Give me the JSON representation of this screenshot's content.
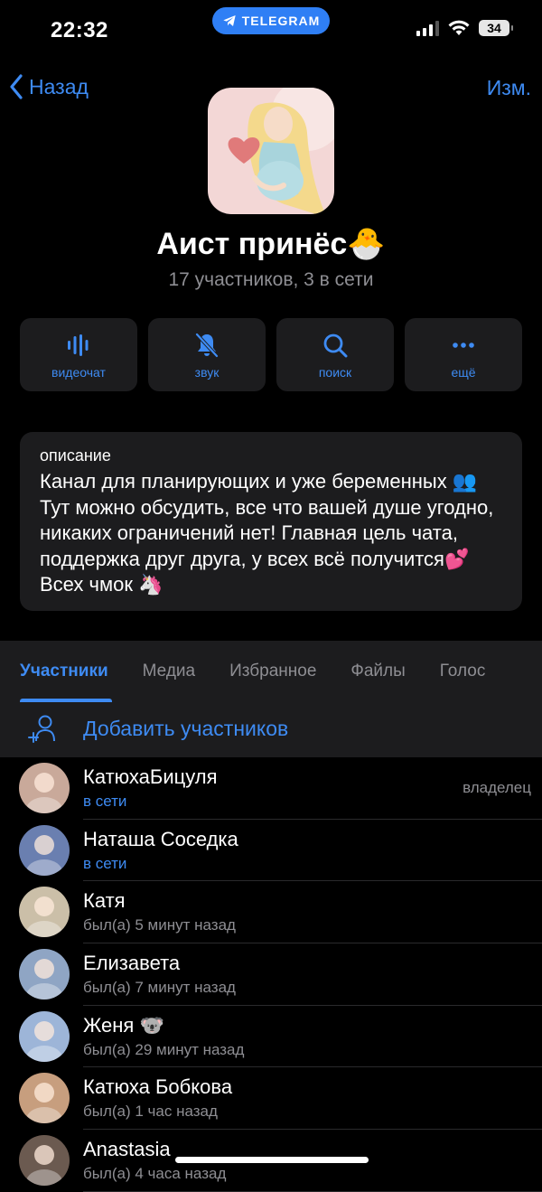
{
  "status": {
    "time": "22:32",
    "pill": "TELEGRAM",
    "battery": "34"
  },
  "nav": {
    "back_label": "Назад",
    "edit_label": "Изм."
  },
  "group": {
    "title": "Аист принёс🐣",
    "subtitle": "17 участников, 3 в сети"
  },
  "actions": [
    {
      "label": "видеочат",
      "icon": "video-chat-icon"
    },
    {
      "label": "звук",
      "icon": "mute-bell-icon"
    },
    {
      "label": "поиск",
      "icon": "search-icon"
    },
    {
      "label": "ещё",
      "icon": "more-icon"
    }
  ],
  "description": {
    "label": "описание",
    "text": "Канал для планирующих и уже беременных 👥 Тут можно обсудить, все что вашей душе угодно, никаких ограничений нет! Главная цель чата, поддержка друг друга, у всех всё получится💕 Всех чмок 🦄"
  },
  "tabs": [
    "Участники",
    "Медиа",
    "Избранное",
    "Файлы",
    "Голос"
  ],
  "add_members_label": "Добавить участников",
  "members": [
    {
      "name": "КатюхаБицуля",
      "status": "в сети",
      "online": true,
      "role": "владелец",
      "color": "#c9a99a"
    },
    {
      "name": "Наташа Соседка",
      "status": "в сети",
      "online": true,
      "role": "",
      "color": "#6a7fb0"
    },
    {
      "name": "Катя",
      "status": "был(а) 5 минут назад",
      "online": false,
      "role": "",
      "color": "#cbbfa8"
    },
    {
      "name": "Елизавета",
      "status": "был(а) 7 минут назад",
      "online": false,
      "role": "",
      "color": "#8fa5c4"
    },
    {
      "name": "Женя 🐨",
      "status": "был(а) 29 минут назад",
      "online": false,
      "role": "",
      "color": "#9db5d8"
    },
    {
      "name": "Катюха Бобкова",
      "status": "был(а) 1 час назад",
      "online": false,
      "role": "",
      "color": "#c79e7e"
    },
    {
      "name": "Anastasia",
      "status": "был(а) 4 часа назад",
      "online": false,
      "role": "",
      "color": "#6b5a50"
    }
  ],
  "colors": {
    "accent": "#3e8bf3",
    "panel": "#1c1c1e",
    "muted": "#8e8e93"
  }
}
